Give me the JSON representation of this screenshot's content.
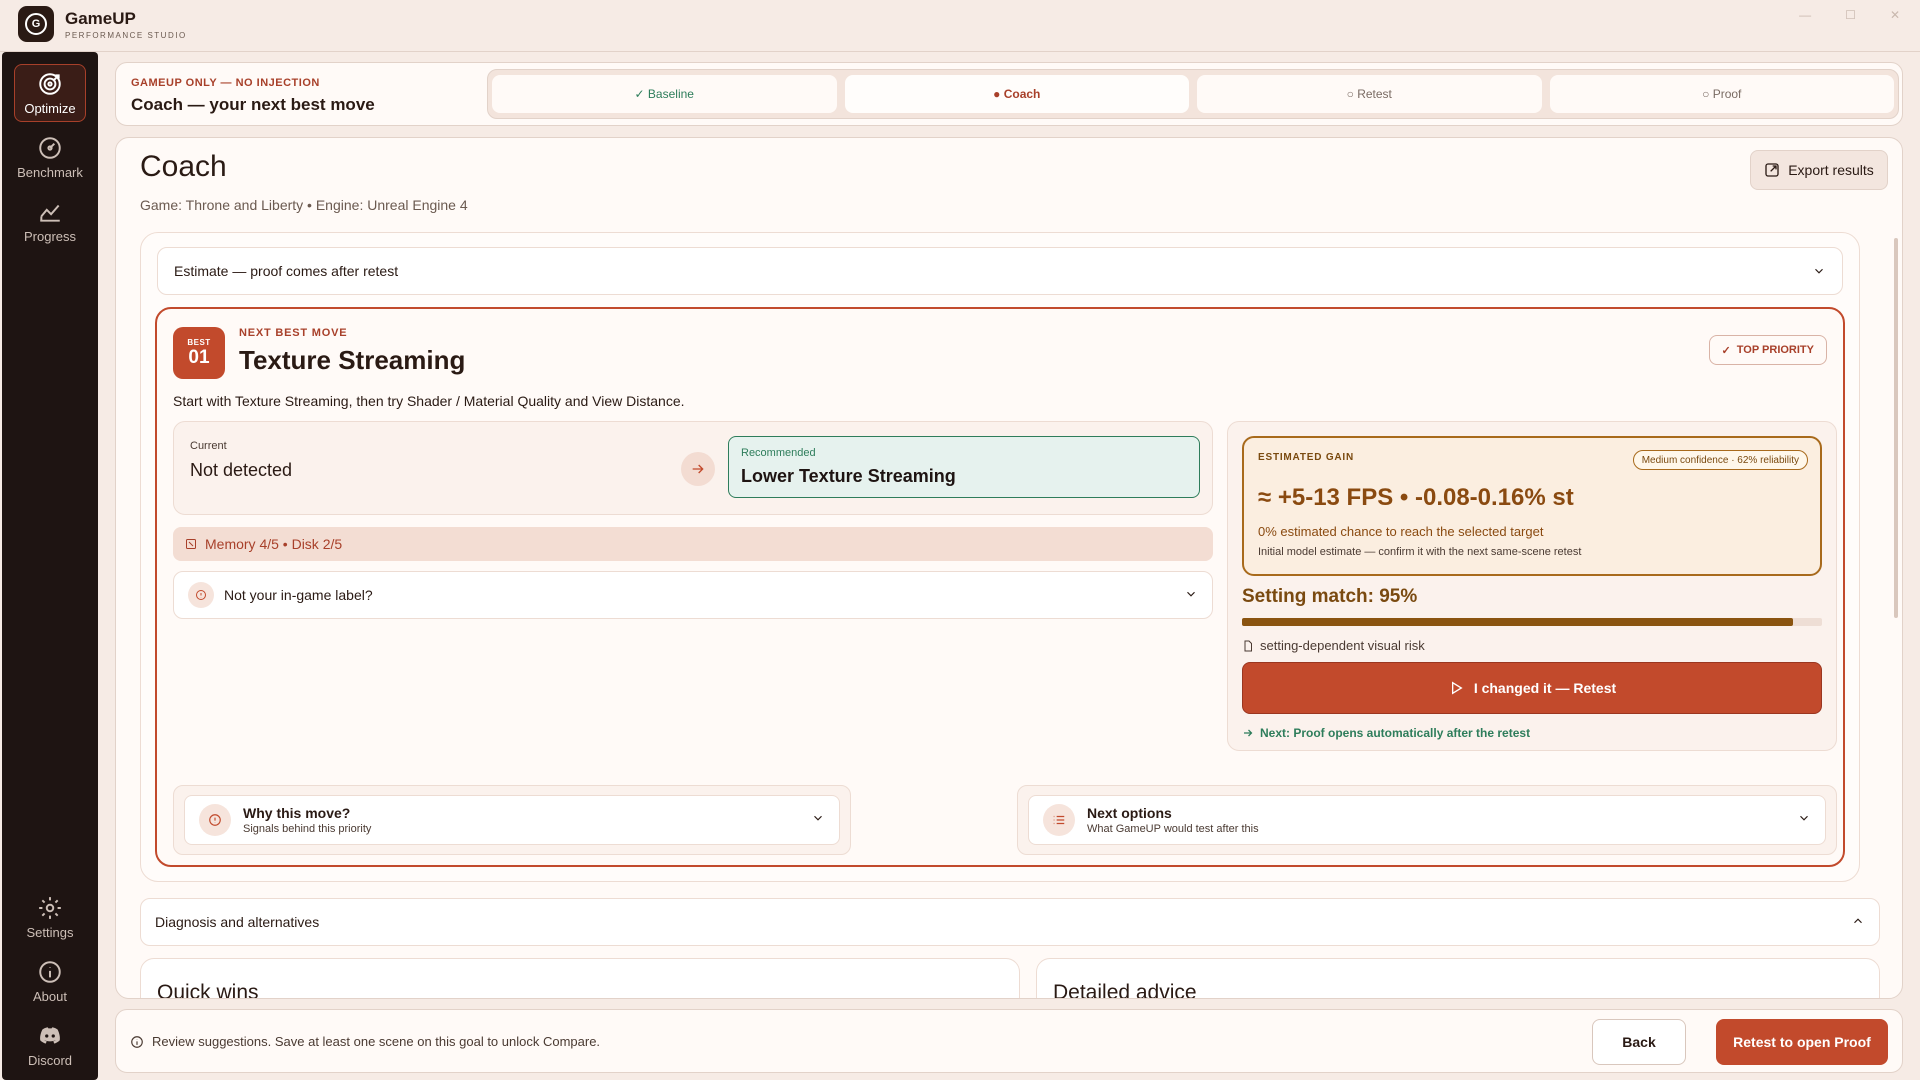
{
  "app": {
    "name": "GameUP",
    "subtitle": "PERFORMANCE STUDIO"
  },
  "sidebar": {
    "items": [
      {
        "label": "Optimize",
        "icon": "target-icon",
        "active": true
      },
      {
        "label": "Benchmark",
        "icon": "speedometer-icon",
        "active": false
      },
      {
        "label": "Progress",
        "icon": "chart-icon",
        "active": false
      },
      {
        "label": "Settings",
        "icon": "gear-icon",
        "active": false
      },
      {
        "label": "About",
        "icon": "info-icon",
        "active": false
      },
      {
        "label": "Discord",
        "icon": "discord-icon",
        "active": false
      }
    ]
  },
  "stepbar": {
    "kicker": "GAMEUP ONLY — NO INJECTION",
    "title": "Coach — your next best move",
    "steps": [
      {
        "label": "✓ Baseline",
        "state": "done"
      },
      {
        "label": "● Coach",
        "state": "current"
      },
      {
        "label": "○ Retest",
        "state": "pending"
      },
      {
        "label": "○ Proof",
        "state": "pending"
      }
    ]
  },
  "page": {
    "title": "Coach",
    "meta": "Game: Throne and Liberty • Engine: Unreal Engine 4",
    "export_label": "Export results"
  },
  "estimate": {
    "label": "Estimate — proof comes after retest"
  },
  "move": {
    "badge_label": "BEST",
    "rank": "01",
    "kicker": "NEXT BEST MOVE",
    "title": "Texture Streaming",
    "priority": "TOP PRIORITY",
    "description": "Start with Texture Streaming, then try Shader / Material Quality and View Distance.",
    "current_label": "Current",
    "current_value": "Not detected",
    "recommended_label": "Recommended",
    "recommended_value": "Lower Texture Streaming",
    "resources": "Memory 4/5 • Disk 2/5",
    "label_question": "Not your in-game label?"
  },
  "gain": {
    "kicker": "ESTIMATED GAIN",
    "confidence": "Medium confidence · 62% reliability",
    "value": "≈ +5-13 FPS • -0.08-0.16% st",
    "chance": "0% estimated chance to reach the selected target",
    "note": "Initial model estimate — confirm it with the next same-scene retest",
    "match_title": "Setting match: 95%",
    "match_fraction": 0.95,
    "risk": "setting-dependent visual risk",
    "retest_label": "I changed it — Retest",
    "next_line": "Next: Proof opens automatically after the retest"
  },
  "expanders": {
    "why": {
      "title": "Why this move?",
      "subtitle": "Signals behind this priority"
    },
    "next": {
      "title": "Next options",
      "subtitle": "What GameUP would test after this"
    }
  },
  "diagnosis": {
    "label": "Diagnosis and alternatives"
  },
  "cards": {
    "quick_wins": "Quick wins",
    "detailed_advice": "Detailed advice"
  },
  "footer": {
    "message": "Review suggestions. Save at least one scene on this goal to unlock Compare.",
    "back_label": "Back",
    "primary_label": "Retest to open Proof"
  },
  "colors": {
    "accent": "#c24a2c",
    "success": "#2e7d5b",
    "gain": "#8a4a10",
    "sidebar": "#1e1412"
  }
}
